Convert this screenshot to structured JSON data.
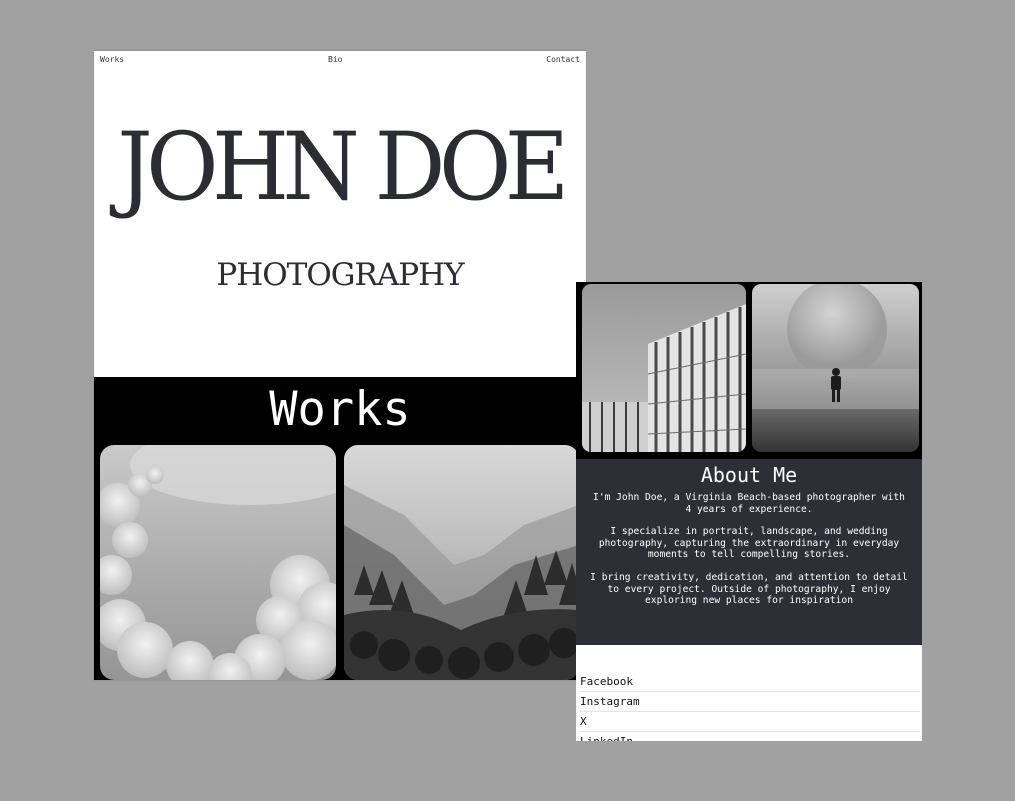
{
  "portfolio": {
    "nav": {
      "works": "Works",
      "bio": "Bio",
      "contact": "Contact"
    },
    "title": "JOHN DOE",
    "subtitle": "PHOTOGRAPHY",
    "works_heading": "Works",
    "works_images": [
      "clouds-photo",
      "misty-forest-photo"
    ]
  },
  "about_page": {
    "top_images": [
      "building-facade-photo",
      "astronaut-in-fog-photo"
    ],
    "heading": "About Me",
    "paragraph1": "I'm John Doe, a Virginia Beach-based photographer with\n4 years of experience.",
    "paragraph2": "I specialize in portrait, landscape, and wedding\nphotography, capturing the extraordinary in everyday\nmoments to tell compelling stories.",
    "paragraph3": "I bring creativity, dedication, and attention to detail\nto every project. Outside of photography, I enjoy\nexploring new places for inspiration",
    "social_links": [
      "Facebook",
      "Instagram",
      "X",
      "LinkedIn"
    ]
  },
  "colors": {
    "background": "#a1a1a1",
    "title_text": "#2c2c33",
    "about_bg": "#2e2e37",
    "band_bg": "#000000"
  }
}
